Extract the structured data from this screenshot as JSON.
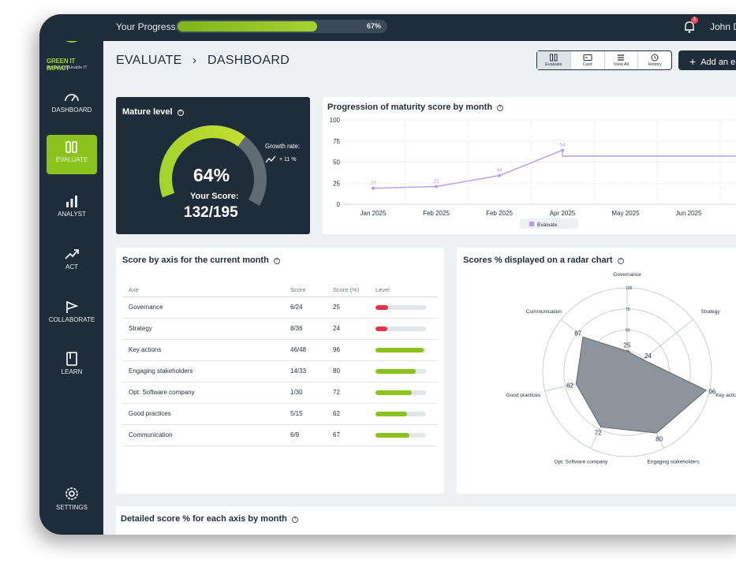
{
  "topbar": {
    "progress_label": "Your Progress:",
    "progress_value": 0.67,
    "progress_text": "67%",
    "notification_count": "1",
    "user_name": "John D"
  },
  "brand": {
    "name": "GREEN IT IMPACT",
    "tagline": "Act for sustainable IT",
    "accent": "#8cc21e",
    "navy": "#1f2d3a"
  },
  "sidebar": {
    "items": [
      {
        "label": "DASHBOARD",
        "icon": "gauge-icon"
      },
      {
        "label": "EVALUATE",
        "icon": "evaluate-icon",
        "active": true
      },
      {
        "label": "ANALYST",
        "icon": "bar-chart-icon"
      },
      {
        "label": "ACT",
        "icon": "trend-up-icon"
      },
      {
        "label": "COLLABORATE",
        "icon": "flag-icon"
      },
      {
        "label": "LEARN",
        "icon": "book-icon"
      },
      {
        "label": "SETTINGS",
        "icon": "gear-icon"
      }
    ]
  },
  "header": {
    "breadcrumb_1": "EVALUATE",
    "breadcrumb_sep": "›",
    "breadcrumb_2": "DASHBOARD",
    "views": [
      {
        "label": "Evaluate",
        "icon": "evaluate-icon",
        "active": true
      },
      {
        "label": "Card",
        "icon": "card-icon"
      },
      {
        "label": "View All",
        "icon": "list-icon"
      },
      {
        "label": "History",
        "icon": "history-icon"
      }
    ],
    "add_button": "Add an e"
  },
  "mature": {
    "title": "Mature level",
    "percent": "64%",
    "gauge_value": 0.64,
    "score_label": "Your Score:",
    "score": "132/195",
    "growth_label": "Growth rate:",
    "growth_value": "+ 11 %"
  },
  "progression": {
    "title": "Progression of maturity score by month",
    "legend": "Evaluate"
  },
  "axes_table": {
    "title": "Score by axis for the current month",
    "headers": [
      "Axe",
      "Score",
      "Score (%)",
      "Level"
    ],
    "rows": [
      {
        "axe": "Governance",
        "score": "6/24",
        "pct": "25",
        "level": 0.25,
        "color": "#e3344a"
      },
      {
        "axe": "Strategy",
        "score": "8/36",
        "pct": "24",
        "level": 0.24,
        "color": "#e3344a"
      },
      {
        "axe": "Key actions",
        "score": "46/48",
        "pct": "96",
        "level": 0.96,
        "color": "#8cc21e"
      },
      {
        "axe": "Engaging stakeholders",
        "score": "14/33",
        "pct": "80",
        "level": 0.8,
        "color": "#8cc21e"
      },
      {
        "axe": "Opt: Software company",
        "score": "1/30",
        "pct": "72",
        "level": 0.72,
        "color": "#8cc21e"
      },
      {
        "axe": "Good practices",
        "score": "5/15",
        "pct": "62",
        "level": 0.62,
        "color": "#8cc21e"
      },
      {
        "axe": "Communication",
        "score": "6/9",
        "pct": "67",
        "level": 0.67,
        "color": "#8cc21e"
      }
    ]
  },
  "radar": {
    "title": "Scores % displayed on a radar chart"
  },
  "detail": {
    "title": "Detailed score % for each axis by month",
    "y_top": "100"
  },
  "chart_data": [
    {
      "type": "line",
      "title": "Progression of maturity score by month",
      "categories": [
        "Jan 2025",
        "Feb 2025",
        "Feb 2025",
        "Apr 2025",
        "May 2025",
        "Jun 2025"
      ],
      "series": [
        {
          "name": "Evaluate",
          "values": [
            19,
            21,
            34,
            64,
            null,
            null
          ],
          "flat_after": 57
        }
      ],
      "ylim": [
        0,
        100
      ],
      "yticks": [
        0,
        25,
        50,
        75,
        100
      ],
      "grid": true,
      "legend": "bottom"
    },
    {
      "type": "radar",
      "title": "Scores % displayed on a radar chart",
      "categories": [
        "Governance",
        "Strategy",
        "Key actions",
        "Engaging stakeholders",
        "Opt: Software company",
        "Good practices",
        "Communication"
      ],
      "values": [
        25,
        24,
        96,
        80,
        72,
        62,
        67
      ],
      "rlim": [
        0,
        100
      ],
      "rticks": [
        "0",
        "25",
        "50",
        "75",
        "100"
      ]
    }
  ]
}
